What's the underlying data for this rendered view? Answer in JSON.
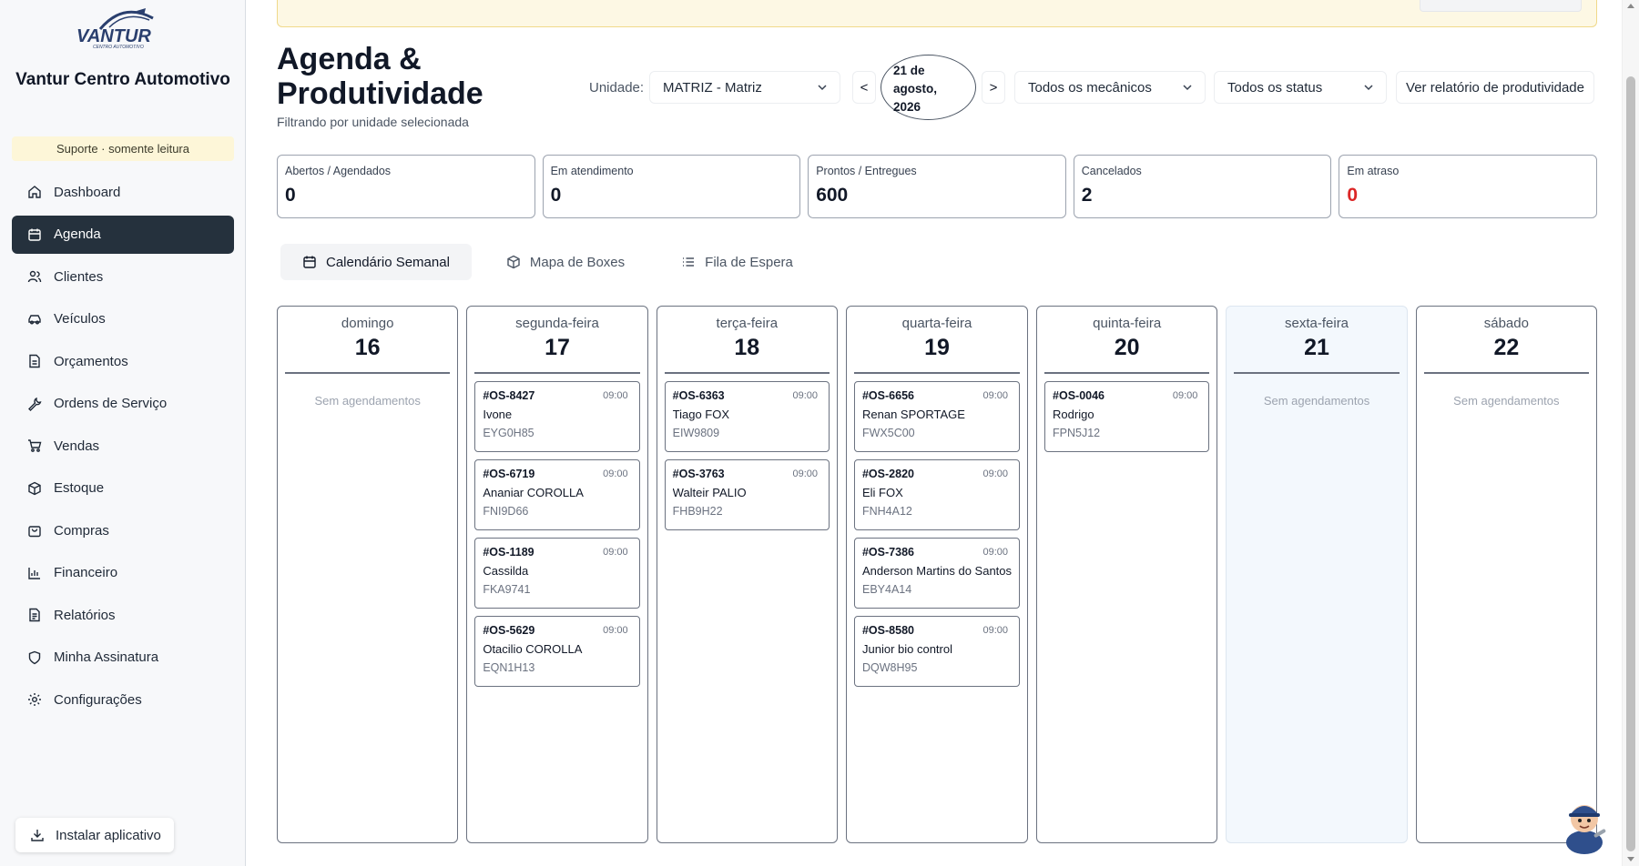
{
  "sidebar": {
    "brand_name": "Vantur Centro Automotivo",
    "logo_text": "VANTUR",
    "support_badge": "Suporte · somente leitura",
    "items": [
      {
        "label": "Dashboard",
        "icon": "home-icon"
      },
      {
        "label": "Agenda",
        "icon": "calendar-icon",
        "active": true
      },
      {
        "label": "Clientes",
        "icon": "users-icon"
      },
      {
        "label": "Veículos",
        "icon": "car-icon"
      },
      {
        "label": "Orçamentos",
        "icon": "document-icon"
      },
      {
        "label": "Ordens de Serviço",
        "icon": "wrench-icon"
      },
      {
        "label": "Vendas",
        "icon": "cart-icon"
      },
      {
        "label": "Estoque",
        "icon": "box-icon"
      },
      {
        "label": "Compras",
        "icon": "bag-icon"
      },
      {
        "label": "Financeiro",
        "icon": "chart-icon"
      },
      {
        "label": "Relatórios",
        "icon": "report-icon"
      },
      {
        "label": "Minha Assinatura",
        "icon": "shield-icon"
      },
      {
        "label": "Configurações",
        "icon": "gear-icon"
      }
    ],
    "install_label": "Instalar aplicativo"
  },
  "header": {
    "title": "Agenda & Produtividade",
    "subtitle": "Filtrando por unidade selecionada",
    "unit_label": "Unidade:",
    "unit_value": "MATRIZ - Matriz",
    "prev_label": "<",
    "next_label": ">",
    "date_line1": "21 de",
    "date_line2": "agosto,",
    "date_line3": "2026",
    "mechanics_filter": "Todos os mecânicos",
    "status_filter": "Todos os status",
    "report_button": "Ver relatório de produtividade"
  },
  "kpis": [
    {
      "label": "Abertos / Agendados",
      "value": "0"
    },
    {
      "label": "Em atendimento",
      "value": "0"
    },
    {
      "label": "Prontos / Entregues",
      "value": "600"
    },
    {
      "label": "Cancelados",
      "value": "2"
    },
    {
      "label": "Em atraso",
      "value": "0",
      "alert": true
    }
  ],
  "tabs": [
    {
      "label": "Calendário Semanal",
      "icon": "calendar-icon",
      "active": true
    },
    {
      "label": "Mapa de Boxes",
      "icon": "box-icon"
    },
    {
      "label": "Fila de Espera",
      "icon": "list-icon"
    }
  ],
  "week": {
    "empty_label": "Sem agendamentos",
    "days": [
      {
        "name": "domingo",
        "num": "16",
        "cards": []
      },
      {
        "name": "segunda-feira",
        "num": "17",
        "cards": [
          {
            "os": "#OS-8427",
            "time": "09:00",
            "client": "Ivone",
            "plate": "EYG0H85"
          },
          {
            "os": "#OS-6719",
            "time": "09:00",
            "client": "Ananiar COROLLA",
            "plate": "FNI9D66"
          },
          {
            "os": "#OS-1189",
            "time": "09:00",
            "client": "Cassilda",
            "plate": "FKA9741"
          },
          {
            "os": "#OS-5629",
            "time": "09:00",
            "client": "Otacilio COROLLA",
            "plate": "EQN1H13"
          }
        ]
      },
      {
        "name": "terça-feira",
        "num": "18",
        "cards": [
          {
            "os": "#OS-6363",
            "time": "09:00",
            "client": "Tiago FOX",
            "plate": "EIW9809"
          },
          {
            "os": "#OS-3763",
            "time": "09:00",
            "client": "Walteir PALIO",
            "plate": "FHB9H22"
          }
        ]
      },
      {
        "name": "quarta-feira",
        "num": "19",
        "cards": [
          {
            "os": "#OS-6656",
            "time": "09:00",
            "client": "Renan SPORTAGE",
            "plate": "FWX5C00"
          },
          {
            "os": "#OS-2820",
            "time": "09:00",
            "client": "Eli FOX",
            "plate": "FNH4A12"
          },
          {
            "os": "#OS-7386",
            "time": "09:00",
            "client": "Anderson Martins do Santos",
            "plate": "EBY4A14"
          },
          {
            "os": "#OS-8580",
            "time": "09:00",
            "client": "Junior bio control",
            "plate": "DQW8H95"
          }
        ]
      },
      {
        "name": "quinta-feira",
        "num": "20",
        "cards": [
          {
            "os": "#OS-0046",
            "time": "09:00",
            "client": "Rodrigo",
            "plate": "FPN5J12"
          }
        ]
      },
      {
        "name": "sexta-feira",
        "num": "21",
        "today": true,
        "cards": []
      },
      {
        "name": "sábado",
        "num": "22",
        "cards": []
      }
    ]
  },
  "colors": {
    "active_nav": "#25313d",
    "alert": "#dc2626",
    "badge_bg": "#fdf6d8",
    "today_bg": "#f3f8fd"
  }
}
